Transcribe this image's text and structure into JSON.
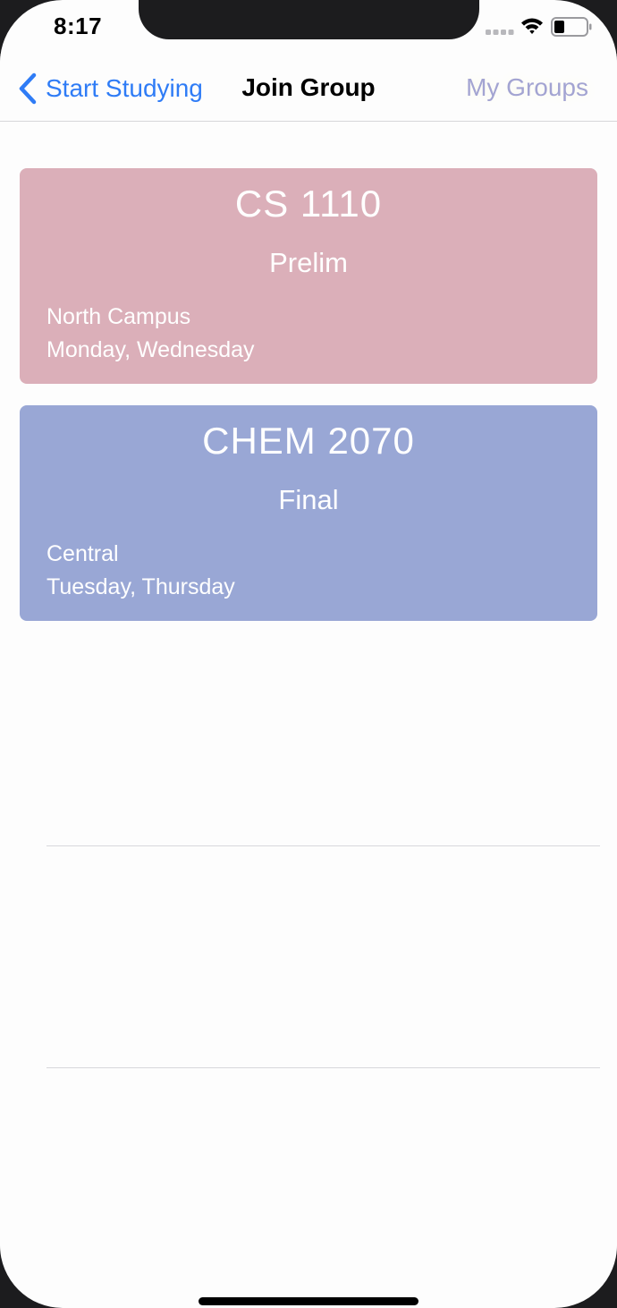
{
  "status_bar": {
    "time": "8:17"
  },
  "nav": {
    "back_label": "Start Studying",
    "title": "Join Group",
    "right_label": "My Groups",
    "accent_color": "#2f7cf6",
    "right_color": "#a3a4d2"
  },
  "cards": [
    {
      "course": "CS 1110",
      "exam": "Prelim",
      "location": "North Campus",
      "days": "Monday, Wednesday",
      "color": "#dbafb9"
    },
    {
      "course": "CHEM 2070",
      "exam": "Final",
      "location": "Central",
      "days": "Tuesday, Thursday",
      "color": "#99a7d5"
    }
  ]
}
